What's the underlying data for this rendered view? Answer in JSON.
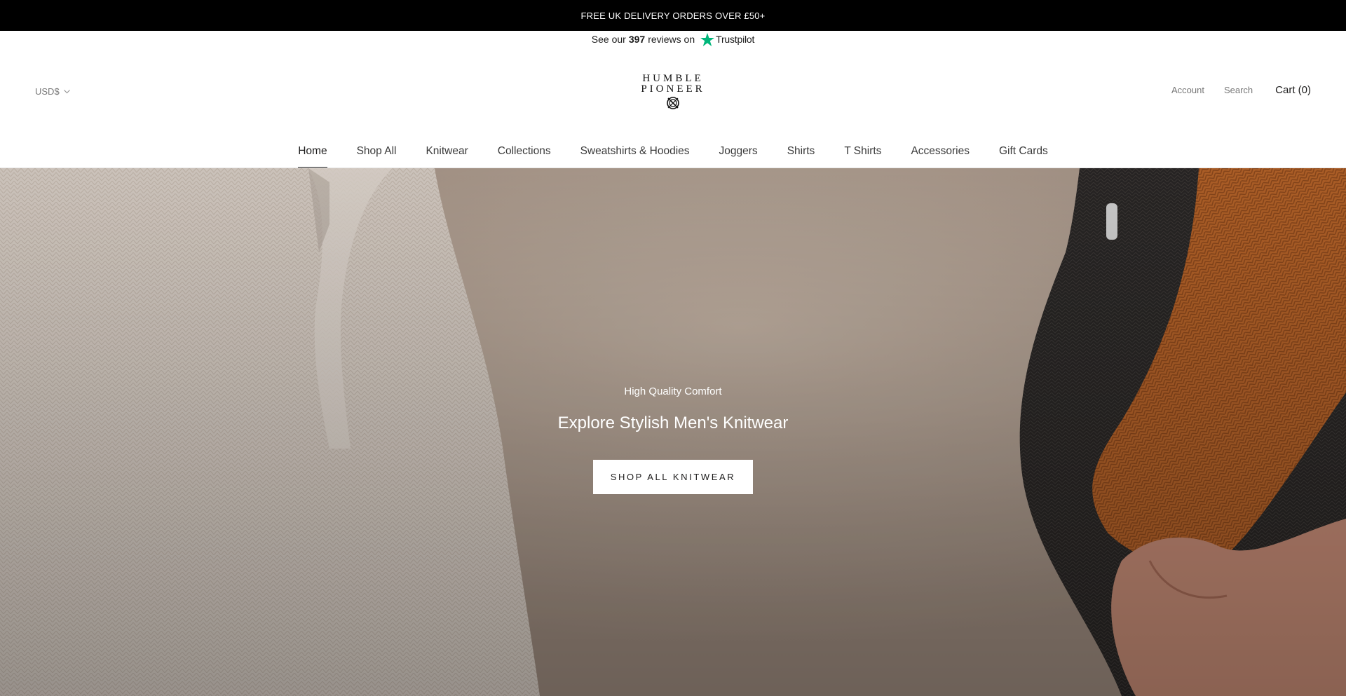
{
  "announcement": {
    "text": "FREE UK DELIVERY ORDERS OVER £50+"
  },
  "trustpilot": {
    "prefix": "See our",
    "count": "397",
    "suffix": "reviews on",
    "brand": "Trustpilot",
    "star_color": "#00b67a"
  },
  "header": {
    "currency": "USD$",
    "logo": {
      "line1": "HUMBLE",
      "line2": "PIONEER"
    },
    "account": "Account",
    "search": "Search",
    "cart": "Cart (0)"
  },
  "nav": {
    "active_index": 0,
    "items": [
      "Home",
      "Shop All",
      "Knitwear",
      "Collections",
      "Sweatshirts & Hoodies",
      "Joggers",
      "Shirts",
      "T Shirts",
      "Accessories",
      "Gift Cards"
    ]
  },
  "hero": {
    "eyebrow": "High Quality Comfort",
    "title": "Explore Stylish Men's Knitwear",
    "button": "SHOP ALL KNITWEAR"
  },
  "colors": {
    "announcement_bg": "#000000",
    "accent_orange": "#b9652a",
    "text_dark": "#1c1b1b",
    "text_muted": "#777777"
  },
  "icons": {
    "currency_caret": "chevron-down-icon",
    "trustpilot_star": "star-icon",
    "logo_mark": "compass-icon"
  }
}
